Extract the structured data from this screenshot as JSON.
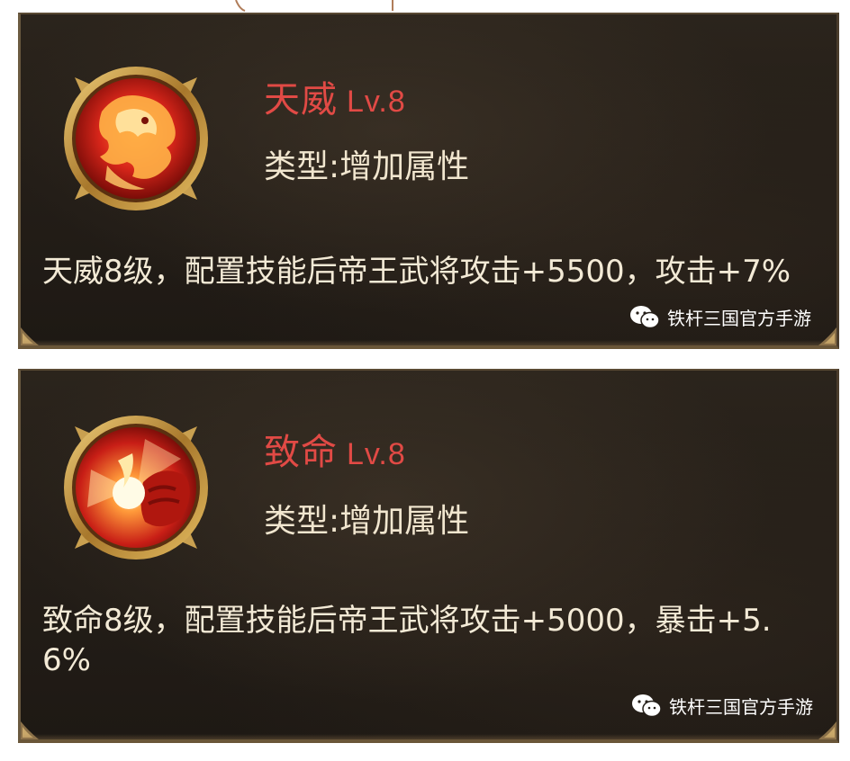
{
  "colors": {
    "title_red": "#e14a45",
    "text_cream": "#f1e6cf",
    "panel_bg": "#241e18",
    "gold_frame": "#b8903c"
  },
  "watermark": "铁杆三国官方手游",
  "skills": [
    {
      "name": "天威",
      "level": "Lv.8",
      "type": "类型:增加属性",
      "description": "天威8级，配置技能后帝王武将攻击+5500，攻击+7%",
      "icon": "flaming-lion-icon"
    },
    {
      "name": "致命",
      "level": "Lv.8",
      "type": "类型:增加属性",
      "description": "致命8级，配置技能后帝王武将攻击+5000，暴击+5.6%",
      "icon": "flaming-fist-icon"
    }
  ]
}
